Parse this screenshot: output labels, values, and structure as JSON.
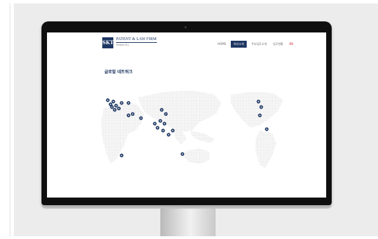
{
  "page": {
    "background": "#ececec"
  },
  "site": {
    "logo": {
      "mark": "SKT",
      "name": "PATENT & LAW FIRM",
      "subtitle": "특허법률사무소"
    },
    "nav": {
      "items": [
        {
          "label": "HOME",
          "state": "normal"
        },
        {
          "label": "회사소개",
          "state": "active"
        },
        {
          "label": "주요업무소개",
          "state": "normal"
        },
        {
          "label": "업무현황",
          "state": "normal"
        },
        {
          "label": "EN",
          "state": "lang"
        }
      ]
    },
    "section_title": "글로벌 네트워크",
    "accent_color": "#1e3763",
    "map": {
      "style": "dotted-grey-world-map",
      "marker_count": 27,
      "marker_color": "#1e3763"
    }
  }
}
